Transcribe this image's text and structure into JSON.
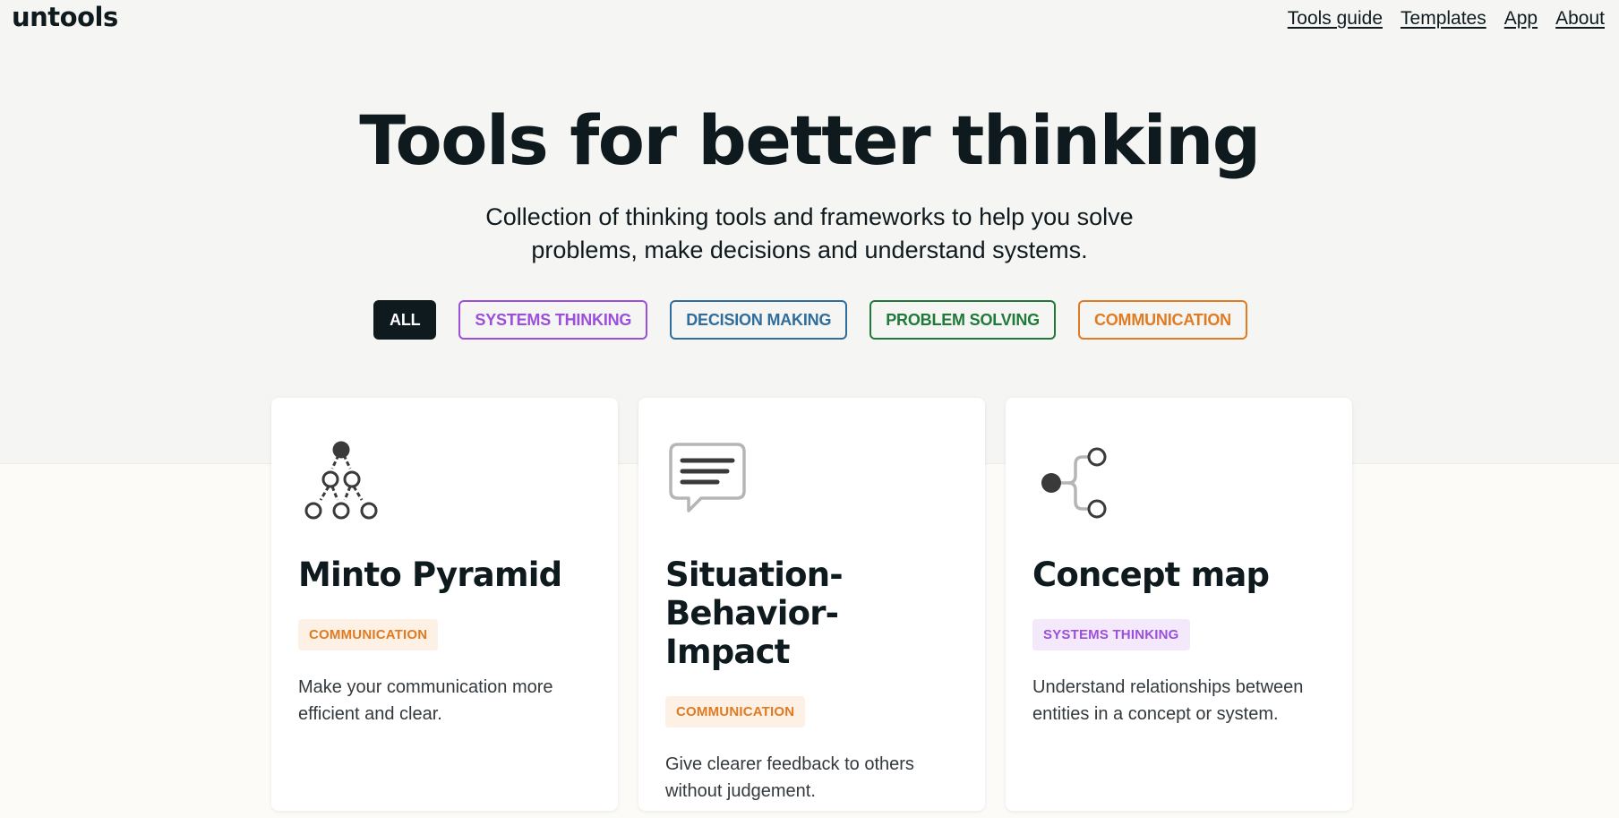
{
  "header": {
    "logo": "untools",
    "nav": [
      {
        "label": "Tools guide"
      },
      {
        "label": "Templates"
      },
      {
        "label": "App"
      },
      {
        "label": "About"
      }
    ]
  },
  "hero": {
    "title": "Tools for better thinking",
    "subtitle": "Collection of thinking tools and frameworks to help you solve problems, make decisions and understand systems."
  },
  "filters": [
    {
      "label": "ALL",
      "color": "#0f1a1e",
      "active": true
    },
    {
      "label": "SYSTEMS THINKING",
      "color": "#9b4fdb",
      "active": false
    },
    {
      "label": "DECISION MAKING",
      "color": "#2f6d9c",
      "active": false
    },
    {
      "label": "PROBLEM SOLVING",
      "color": "#1f7a3a",
      "active": false
    },
    {
      "label": "COMMUNICATION",
      "color": "#e07b22",
      "active": false
    }
  ],
  "cards": [
    {
      "title": "Minto Pyramid",
      "icon": "pyramid-tree-icon",
      "tag": "COMMUNICATION",
      "tag_color": "#e07b22",
      "tag_bg": "#fdf0e4",
      "description": "Make your communication more efficient and clear."
    },
    {
      "title": "Situation-Behavior-Impact",
      "icon": "speech-bubble-icon",
      "tag": "COMMUNICATION",
      "tag_color": "#e07b22",
      "tag_bg": "#fdf0e4",
      "description": "Give clearer feedback to others without judgement."
    },
    {
      "title": "Concept map",
      "icon": "concept-map-icon",
      "tag": "SYSTEMS THINKING",
      "tag_color": "#9b4fdb",
      "tag_bg": "#f3e9fb",
      "description": "Understand relationships between entities in a concept or system."
    }
  ]
}
